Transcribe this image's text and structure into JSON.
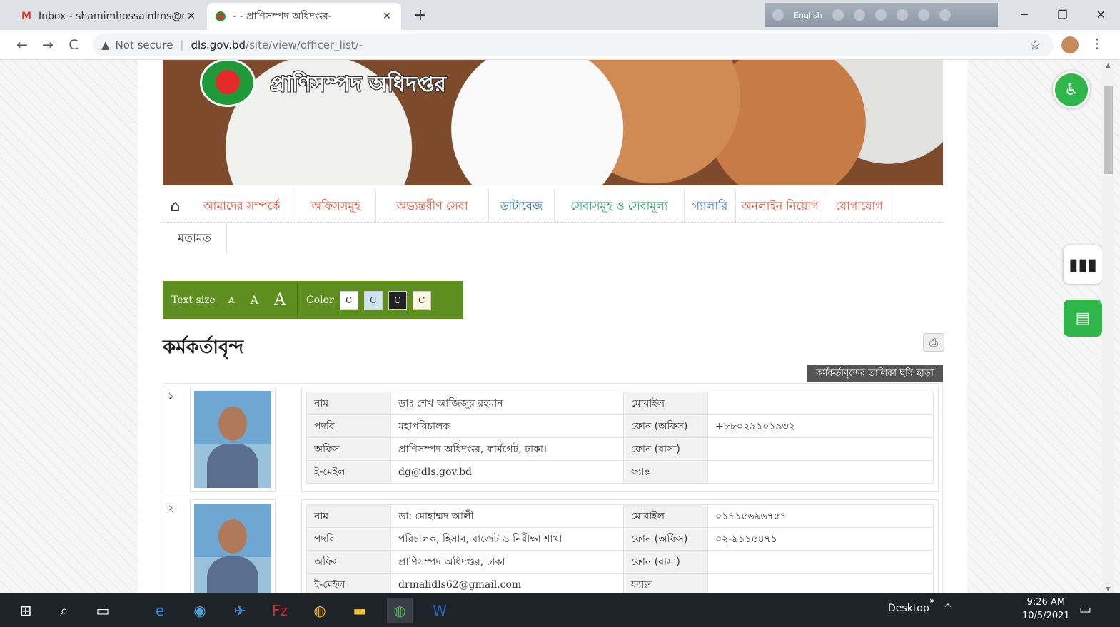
{
  "browser": {
    "tabs": [
      {
        "title": "Inbox - shamimhossainlms@gm",
        "icon": "gmail-icon",
        "close": "✕"
      },
      {
        "title": "- - প্রাণিসম্পদ অধিদপ্তর-",
        "icon": "site-icon",
        "close": "✕"
      }
    ],
    "new_tab": "+",
    "ext_label": "English",
    "window": {
      "minimize": "─",
      "restore": "❐",
      "close": "✕"
    },
    "back": "←",
    "forward": "→",
    "reload": "C",
    "security_warning": "▲",
    "security_text": "Not secure",
    "url_host": "dls.gov.bd",
    "url_path": "/site/view/officer_list/-",
    "star": "☆",
    "menu": "⋮"
  },
  "site": {
    "name": "প্রাণিসম্পদ অধিদপ্তর",
    "nav": [
      {
        "label": "আমাদের সম্পর্কে",
        "color": "#e3492b"
      },
      {
        "label": "অফিসসমূহ",
        "color": "#e3492b"
      },
      {
        "label": "অভ্যন্তরীণ সেবা",
        "color": "#e3492b"
      },
      {
        "label": "ডাটাবেজ",
        "color": "#1f6fa7"
      },
      {
        "label": "সেবাসমূহ ও সেবামূল্য",
        "color": "#1f9a5a"
      },
      {
        "label": "গ্যালারি",
        "color": "#3a6fd6"
      },
      {
        "label": "অনলাইন নিয়োগ",
        "color": "#e3492b"
      },
      {
        "label": "যোগাযোগ",
        "color": "#e3492b"
      }
    ],
    "nav2": "মতামত",
    "home_icon": "⌂",
    "accessibility": {
      "text_size_label": "Text size",
      "sizes": [
        "A",
        "A",
        "A"
      ],
      "color_label": "Color",
      "swatches": [
        "C",
        "C",
        "C",
        "C"
      ],
      "swatch_colors": [
        "#ffffff",
        "#cfe2f3",
        "#222222",
        "#fdf6e3"
      ]
    },
    "page_title": "কর্মকর্তাবৃন্দ",
    "print_icon": "⎙",
    "no_image_btn": "কর্মকর্তাবৃন্দের তালিকা ছবি ছাড়া",
    "labels": {
      "name": "নাম",
      "designation": "পদবি",
      "office": "অফিস",
      "email": "ই-মেইল",
      "mobile": "মোবাইল",
      "phone_office": "ফোন (অফিস)",
      "phone_home": "ফোন (বাসা)",
      "fax": "ফ্যাক্স"
    },
    "officers": [
      {
        "serial": "১",
        "name": "ডাঃ শেখ আজিজুর রহমান",
        "designation": "মহাপরিচালক",
        "office": "প্রাণিসম্পদ অধিদপ্তর, ফার্মগেট, ঢাকা।",
        "email": "dg@dls.gov.bd",
        "mobile": "",
        "phone_office": "+৮৮০২৯১০১৯৩২",
        "phone_home": "",
        "fax": ""
      },
      {
        "serial": "২",
        "name": "ডা: মোহাম্মদ আলী",
        "designation": "পরিচালক, হিসাব, বাজেট ও নিরীক্ষা শাখা",
        "office": "প্রাণিসম্পদ অধিদপ্তর, ঢাকা",
        "email": "drmalidls62@gmail.com",
        "mobile": "০১৭১৫৬৯৬৭৫৭",
        "phone_office": "০২-৯১১৫৪৭১",
        "phone_home": "",
        "fax": ""
      }
    ],
    "widgets": {
      "a11y_icon": "♿",
      "stats_icon": "▮▮▮",
      "chat_icon": "▤"
    }
  },
  "taskbar": {
    "desktop_label": "Desktop",
    "chevron": "»",
    "up": "^",
    "time": "9:26 AM",
    "date": "10/5/2021",
    "apps": [
      {
        "glyph": "⊞",
        "color": "#ffffff"
      },
      {
        "glyph": "⌕",
        "color": "#ffffff"
      },
      {
        "glyph": "▭",
        "color": "#ffffff"
      },
      {
        "glyph": "e",
        "color": "#1e8fe1"
      },
      {
        "glyph": "◉",
        "color": "#4aa3df"
      },
      {
        "glyph": "✈",
        "color": "#3b8fd9"
      },
      {
        "glyph": "Fz",
        "color": "#c62b2b"
      },
      {
        "glyph": "◍",
        "color": "#f2b21b"
      },
      {
        "glyph": "▬",
        "color": "#f0c23b"
      },
      {
        "glyph": "◍",
        "color": "#4caf50"
      },
      {
        "glyph": "W",
        "color": "#2b5fb3"
      }
    ],
    "notif": "▭"
  }
}
